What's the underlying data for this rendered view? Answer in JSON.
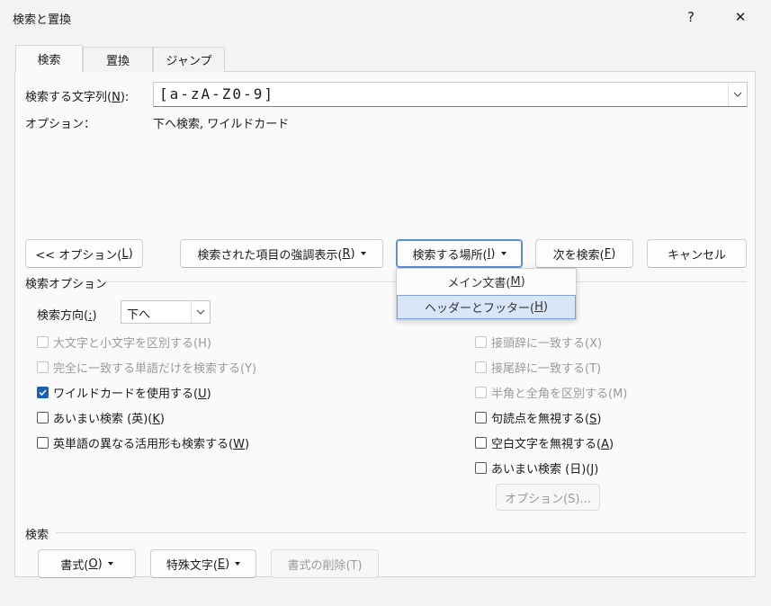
{
  "window": {
    "title": "検索と置換",
    "help_label": "?",
    "close_label": "✕"
  },
  "tabs": [
    {
      "label": "検索",
      "active": true
    },
    {
      "label": "置換",
      "active": false
    },
    {
      "label": "ジャンプ",
      "active": false
    }
  ],
  "search": {
    "label_prefix": "検索する文字列(",
    "label_key": "N",
    "label_suffix": "):",
    "value": "[a-zA-Z0-9]"
  },
  "options": {
    "label": "オプション：",
    "value": "下へ検索, ワイルドカード"
  },
  "buttons": {
    "less_options_prefix": "<< オプション(",
    "less_options_key": "L",
    "less_options_suffix": ")",
    "highlight_prefix": "検索された項目の強調表示(",
    "highlight_key": "R",
    "highlight_suffix": ")",
    "find_in_prefix": "検索する場所(",
    "find_in_key": "I",
    "find_in_suffix": ")",
    "find_next_prefix": "次を検索(",
    "find_next_key": "F",
    "find_next_suffix": ")",
    "cancel": "キャンセル"
  },
  "find_in_menu": [
    {
      "prefix": "メイン文書(",
      "key": "M",
      "suffix": ")",
      "hover": false
    },
    {
      "prefix": "ヘッダーとフッター(",
      "key": "H",
      "suffix": ")",
      "hover": true
    }
  ],
  "search_options": {
    "heading": "検索オプション",
    "direction_prefix": "検索方向(",
    "direction_key": ":",
    "direction_suffix": ")",
    "direction_value": "下へ",
    "left": [
      {
        "prefix": "大文字と小文字を区別する(H)",
        "key": "",
        "suffix": "",
        "checked": false,
        "disabled": true
      },
      {
        "prefix": "完全に一致する単語だけを検索する(Y)",
        "key": "",
        "suffix": "",
        "checked": false,
        "disabled": true
      },
      {
        "prefix": "ワイルドカードを使用する(",
        "key": "U",
        "suffix": ")",
        "checked": true,
        "disabled": false
      },
      {
        "prefix": "あいまい検索 (英)(",
        "key": "K",
        "suffix": ")",
        "checked": false,
        "disabled": false
      },
      {
        "prefix": "英単語の異なる活用形も検索する(",
        "key": "W",
        "suffix": ")",
        "checked": false,
        "disabled": false
      }
    ],
    "right": [
      {
        "prefix": "接頭辞に一致する(X)",
        "key": "",
        "suffix": "",
        "checked": false,
        "disabled": true
      },
      {
        "prefix": "接尾辞に一致する(T)",
        "key": "",
        "suffix": "",
        "checked": false,
        "disabled": true
      },
      {
        "prefix": "半角と全角を区別する(M)",
        "key": "",
        "suffix": "",
        "checked": false,
        "disabled": true
      },
      {
        "prefix": "句読点を無視する(",
        "key": "S",
        "suffix": ")",
        "checked": false,
        "disabled": false
      },
      {
        "prefix": "空白文字を無視する(",
        "key": "A",
        "suffix": ")",
        "checked": false,
        "disabled": false
      },
      {
        "prefix": "あいまい検索 (日)(",
        "key": "J",
        "suffix": ")",
        "checked": false,
        "disabled": false
      }
    ],
    "fuzzy_options_button": "オプション(S)..."
  },
  "find_section": {
    "heading": "検索",
    "format_prefix": "書式(",
    "format_key": "O",
    "format_suffix": ")",
    "special_prefix": "特殊文字(",
    "special_key": "E",
    "special_suffix": ")",
    "clear_format": "書式の削除(T)"
  },
  "colors": {
    "accent": "#1a5fb4",
    "menu_hover": "#d9e6f7"
  }
}
